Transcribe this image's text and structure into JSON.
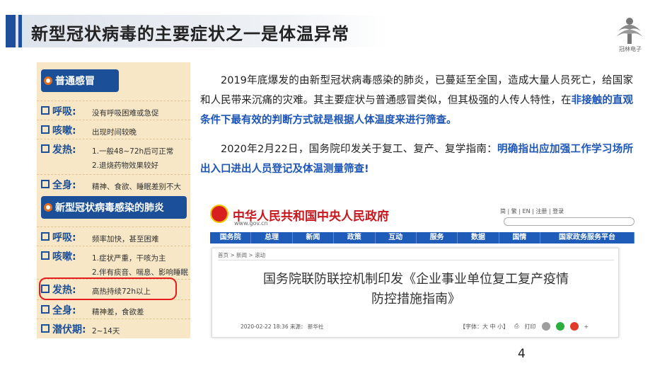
{
  "header": {
    "title": "新型冠状病毒的主要症状之一是体温异常"
  },
  "logo": {
    "text": "冠林电子",
    "icon": "tree-logo-icon"
  },
  "left_panel": {
    "common_cold_title": "普通感冒",
    "common_cold": [
      {
        "label": "呼吸:",
        "lines": [
          "没有呼吸困难或急促"
        ]
      },
      {
        "label": "咳嗽:",
        "lines": [
          "出现时间较晚"
        ]
      },
      {
        "label": "发热:",
        "lines": [
          "1.一般48~72h后可正常",
          "2.退烧药物效果较好"
        ]
      },
      {
        "label": "全身:",
        "lines": [
          "精神、食欲、睡眠差别不大"
        ]
      }
    ],
    "covid_title": "新型冠状病毒感染的肺炎",
    "covid": [
      {
        "label": "呼吸:",
        "lines": [
          "频率加快，甚至困难"
        ]
      },
      {
        "label": "咳嗽:",
        "lines": [
          "1.症状严重，干咳为主",
          "2.伴有痰音、喘息、影响睡眠"
        ]
      },
      {
        "label": "发热:",
        "lines": [
          "高热持续72h以上"
        ]
      },
      {
        "label": "全身:",
        "lines": [
          "精神差，食欲差"
        ]
      },
      {
        "label": "潜伏期:",
        "lines": [
          "2~14天"
        ]
      }
    ]
  },
  "paragraph1": {
    "text": "2019年底爆发的由新型冠状病毒感染的肺炎，已蔓延至全国，造成大量人员死亡，给国家和人民带来沉痛的灾难。其主要症状与普通感冒类似，但其极强的人传人特性，在",
    "emphasis": "非接触的直观条件下最有效的判断方式就是根据人体温度来进行筛查。"
  },
  "paragraph2": {
    "text": "2020年2月22日，国务院印发关于复工、复产、复学指南：",
    "emphasis": "明确指出应加强工作学习场所出入口进出人员登记及体温测量筛查!"
  },
  "gov_site": {
    "name": "中华人民共和国中央人民政府",
    "url": "www.gov.cn",
    "top_links": "简 | 繁 | EN | 注册 | 登录",
    "nav": [
      "国务院",
      "总理",
      "新闻",
      "政策",
      "互动",
      "服务",
      "数据",
      "国情",
      "国家政务服务平台"
    ],
    "breadcrumb": "首页 > 新闻 > 滚动",
    "headline_line1": "国务院联防联控机制印发《企业事业单位复工复产疫情",
    "headline_line2": "防控措施指南》",
    "meta": "2020-02-22 18:36    来源：   新华社",
    "font_size_label": "【字体：大 中 小】",
    "print_label": "打印"
  },
  "page_number": "4"
}
